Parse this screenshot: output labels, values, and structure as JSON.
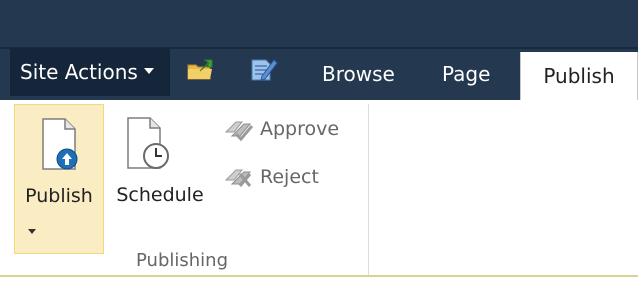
{
  "top_bar": {
    "site_actions_label": "Site Actions",
    "quick_icons": [
      "navigate-up-icon",
      "edit-page-icon"
    ]
  },
  "tabs": [
    {
      "label": "Browse",
      "active": false
    },
    {
      "label": "Page",
      "active": false
    },
    {
      "label": "Publish",
      "active": true
    }
  ],
  "ribbon": {
    "group_label": "Publishing",
    "publish_label": "Publish",
    "schedule_label": "Schedule",
    "approve_label": "Approve",
    "reject_label": "Reject"
  },
  "colors": {
    "top_bar": "#243850",
    "site_actions_bg": "#16263a",
    "selected_button_bg": "#fbedc3",
    "accent_blue": "#1e6fb8"
  }
}
